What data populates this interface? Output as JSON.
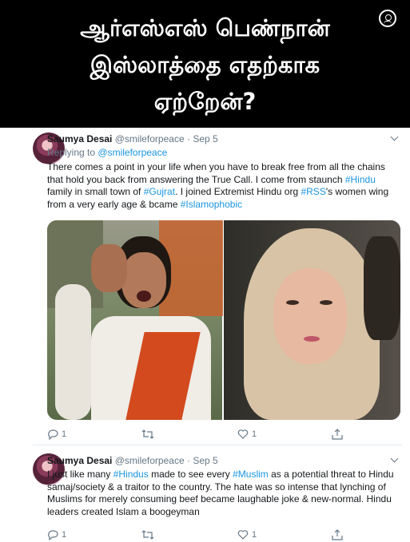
{
  "banner": {
    "line1": "ஆர்எஸ்எஸ் பெண்நான்",
    "line2": "இஸ்லாத்தை எதற்காக",
    "line3": "ஏற்றேன்?"
  },
  "tweets": [
    {
      "name": "Saumya Desai",
      "handle": "@smileforpeace",
      "separator": "·",
      "date": "Sep 5",
      "replying_label": "Replying to",
      "replying_handle": "@smileforpeace",
      "text": {
        "p1": "There comes a point in your life when you have to break free from all the chains that hold you back from answering the True Call. I come from staunch ",
        "h1": "#Hindu",
        "p2": " family in small town of ",
        "h2": "#Gujrat",
        "p3": ". I joined Extremist Hindu org ",
        "h3": "#RSS",
        "p4": "'s women wing from a very early age & bcame ",
        "h4": "#Islamophobic"
      },
      "reply_count": "1",
      "retweet_count": "",
      "like_count": "1"
    },
    {
      "name": "Saumya Desai",
      "handle": "@smileforpeace",
      "separator": "·",
      "date": "Sep 5",
      "text": {
        "p1": "I just like many ",
        "h1": "#Hindus",
        "p2": " made to see every ",
        "h2": "#Muslim",
        "p3": " as a potential threat to Hindu samaj/society & a traitor to the country. The hate was so intense that lynching of Muslims for merely consuming beef became laughable joke & new-normal. Hindu leaders created Islam a boogeyman"
      },
      "reply_count": "1",
      "retweet_count": "",
      "like_count": "1"
    }
  ],
  "icons": {
    "reply": "reply-icon",
    "retweet": "retweet-icon",
    "like": "heart-icon",
    "share": "share-icon",
    "more": "chevron-down-icon",
    "watermark": "user-mark-icon"
  },
  "colors": {
    "banner_bg": "#000000",
    "banner_text": "#ffffff",
    "link": "#1b95e0",
    "meta": "#657786",
    "text": "#14171a"
  }
}
